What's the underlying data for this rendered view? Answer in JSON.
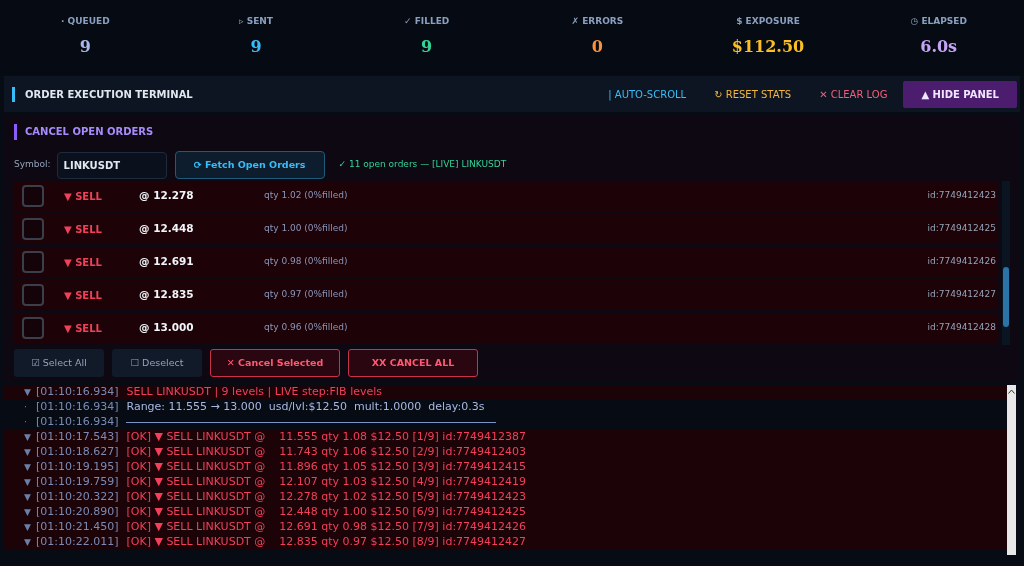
{
  "stats": [
    {
      "icon": "·",
      "label": "QUEUED",
      "value": "9",
      "color": "#a9b8e8"
    },
    {
      "icon": "▹",
      "label": "SENT",
      "value": "9",
      "color": "#38bdf8"
    },
    {
      "icon": "✓",
      "label": "FILLED",
      "value": "9",
      "color": "#34d399"
    },
    {
      "icon": "✗",
      "label": "ERRORS",
      "value": "0",
      "color": "#fb923c"
    },
    {
      "icon": "$",
      "label": "EXPOSURE",
      "value": "$112.50",
      "color": "#fbbf24"
    },
    {
      "icon": "◷",
      "label": "ELAPSED",
      "value": "6.0s",
      "color": "#c4a5f5"
    }
  ],
  "terminal": {
    "title": "ORDER EXECUTION TERMINAL",
    "actions": [
      {
        "kind": "toggle",
        "icon": "|",
        "label": "AUTO-SCROLL",
        "color": "#38bdf8"
      },
      {
        "kind": "plain",
        "icon": "↻",
        "label": "RESET STATS",
        "color": "#f5b63c"
      },
      {
        "kind": "plain",
        "icon": "✕",
        "label": "CLEAR LOG",
        "color": "#f0607a"
      },
      {
        "kind": "primary",
        "icon": "▲",
        "label": "HIDE PANEL"
      }
    ]
  },
  "cancel_panel": {
    "title": "CANCEL OPEN ORDERS",
    "symbol_label": "Symbol:",
    "symbol_value": "LINKUSDT",
    "fetch_button": "⟳ Fetch Open Orders",
    "status": "✓ 11 open orders — [LIVE] LINKUSDT",
    "orders": [
      {
        "checked": false,
        "side": "▼ SELL",
        "price": "@ 12.278",
        "qty": "qty 1.02 (0%filled)",
        "id": "id:7749412423"
      },
      {
        "checked": false,
        "side": "▼ SELL",
        "price": "@ 12.448",
        "qty": "qty 1.00 (0%filled)",
        "id": "id:7749412425"
      },
      {
        "checked": false,
        "side": "▼ SELL",
        "price": "@ 12.691",
        "qty": "qty 0.98 (0%filled)",
        "id": "id:7749412426"
      },
      {
        "checked": false,
        "side": "▼ SELL",
        "price": "@ 12.835",
        "qty": "qty 0.97 (0%filled)",
        "id": "id:7749412427"
      },
      {
        "checked": false,
        "side": "▼ SELL",
        "price": "@ 13.000",
        "qty": "qty 0.96 (0%filled)",
        "id": "id:7749412428"
      }
    ],
    "buttons": [
      {
        "kind": "plain",
        "label": "☑ Select All"
      },
      {
        "kind": "plain",
        "label": "☐ Deselect"
      },
      {
        "kind": "danger",
        "label": "✕ Cancel Selected"
      },
      {
        "kind": "danger",
        "label": "XX CANCEL ALL"
      }
    ]
  },
  "log": [
    {
      "kind": "header",
      "marker": "▼",
      "time": "[01:10:16.934]",
      "text": "SELL LINKUSDT | 9 levels | LIVE step:FIB levels"
    },
    {
      "kind": "info",
      "marker": "·",
      "time": "[01:10:16.934]",
      "text": "Range: 11.555 → 13.000  usd/lvl:$12.50  mult:1.0000  delay:0.3s"
    },
    {
      "kind": "divider",
      "marker": "·",
      "time": "[01:10:16.934]"
    },
    {
      "kind": "order",
      "marker": "▼",
      "time": "[01:10:17.543]",
      "text": "[OK] ▼ SELL LINKUSDT @    11.555 qty 1.08 $12.50 [1/9] id:7749412387"
    },
    {
      "kind": "order",
      "marker": "▼",
      "time": "[01:10:18.627]",
      "text": "[OK] ▼ SELL LINKUSDT @    11.743 qty 1.06 $12.50 [2/9] id:7749412403"
    },
    {
      "kind": "order",
      "marker": "▼",
      "time": "[01:10:19.195]",
      "text": "[OK] ▼ SELL LINKUSDT @    11.896 qty 1.05 $12.50 [3/9] id:7749412415"
    },
    {
      "kind": "order",
      "marker": "▼",
      "time": "[01:10:19.759]",
      "text": "[OK] ▼ SELL LINKUSDT @    12.107 qty 1.03 $12.50 [4/9] id:7749412419"
    },
    {
      "kind": "order",
      "marker": "▼",
      "time": "[01:10:20.322]",
      "text": "[OK] ▼ SELL LINKUSDT @    12.278 qty 1.02 $12.50 [5/9] id:7749412423"
    },
    {
      "kind": "order",
      "marker": "▼",
      "time": "[01:10:20.890]",
      "text": "[OK] ▼ SELL LINKUSDT @    12.448 qty 1.00 $12.50 [6/9] id:7749412425"
    },
    {
      "kind": "order",
      "marker": "▼",
      "time": "[01:10:21.450]",
      "text": "[OK] ▼ SELL LINKUSDT @    12.691 qty 0.98 $12.50 [7/9] id:7749412426"
    },
    {
      "kind": "order",
      "marker": "▼",
      "time": "[01:10:22.011]",
      "text": "[OK] ▼ SELL LINKUSDT @    12.835 qty 0.97 $12.50 [8/9] id:7749412427"
    }
  ]
}
